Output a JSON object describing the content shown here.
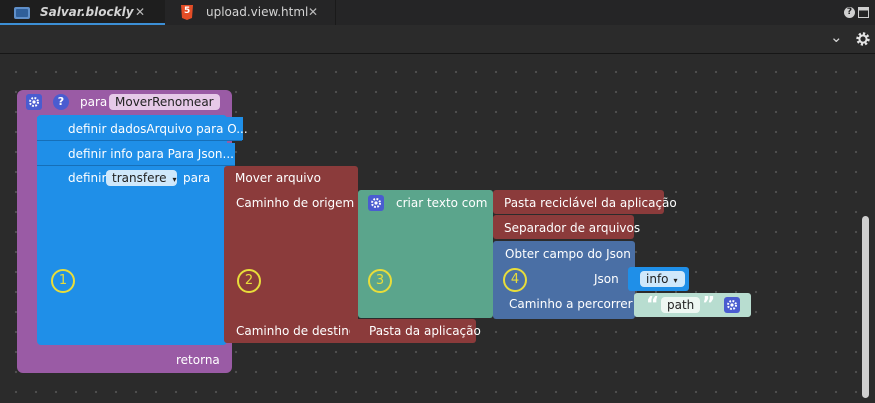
{
  "tabs": [
    {
      "label": "Salvar.blockly",
      "close": "✕",
      "icon": "blockly-file-icon"
    },
    {
      "label": "upload.view.html",
      "close": "✕",
      "icon": "html5-icon",
      "badge": "5"
    }
  ],
  "window_controls": {
    "help": "?"
  },
  "toolbar": {
    "dropdown": "⌄"
  },
  "colors": {
    "procedure": "#9a5ba5",
    "variable": "#1f8fe8",
    "file": "#8b3b3b",
    "text": "#5ba58c",
    "json": "#4a6fa5"
  },
  "blocks": {
    "procedure": {
      "keyword": "para",
      "name": "MoverRenomear",
      "return": "retorna"
    },
    "set1": "definir dadosArquivo para O...",
    "set2": "definir info para Para Json...",
    "set3": {
      "keyword": "definir",
      "var": "transfere",
      "to": "para"
    },
    "move": {
      "title": "Mover arquivo",
      "origin": "Caminho de origem",
      "dest": "Caminho de destino"
    },
    "create_text": "criar texto com",
    "recycle_folder": "Pasta reciclável da aplicação",
    "separator": "Separador de arquivos",
    "json_get": {
      "title": "Obter campo do Json",
      "json": "Json",
      "json_var": "info",
      "path_label": "Caminho a percorrer"
    },
    "text_value": "path",
    "quote_open": "“",
    "quote_close": "”",
    "app_folder": "Pasta da aplicação"
  },
  "markers": [
    "1",
    "2",
    "3",
    "4"
  ]
}
